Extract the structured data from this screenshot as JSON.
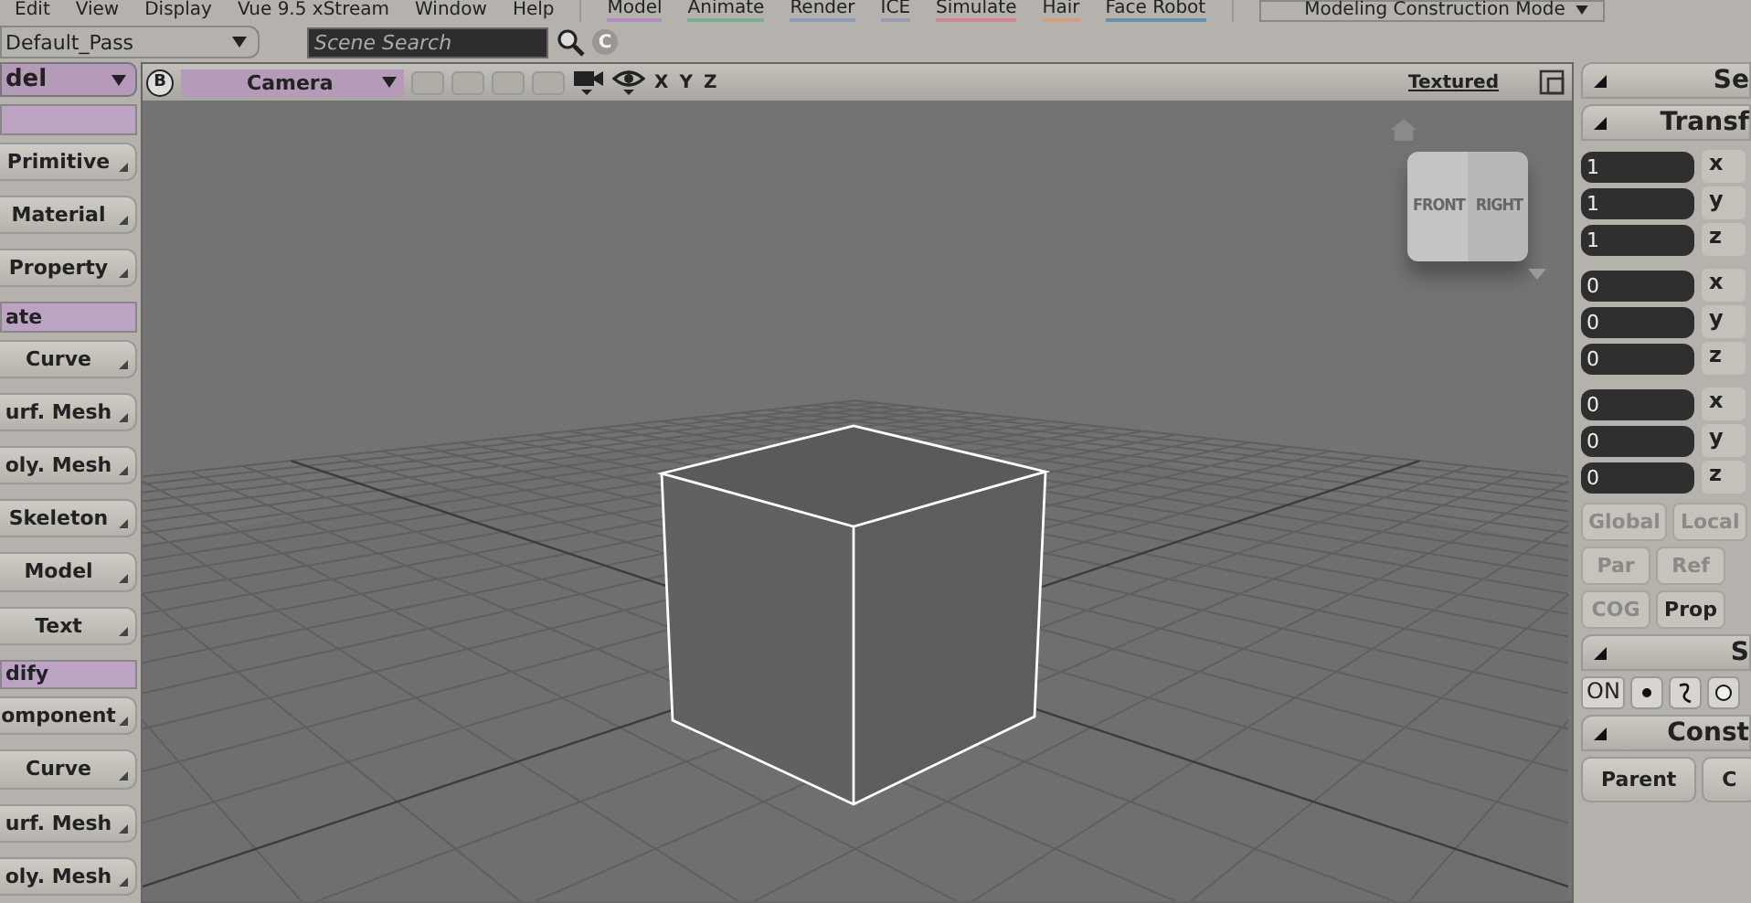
{
  "menu": [
    "Edit",
    "View",
    "Display",
    "Vue 9.5 xStream",
    "Window",
    "Help"
  ],
  "modules": [
    {
      "label": "Model",
      "color": "#b48cc0"
    },
    {
      "label": "Animate",
      "color": "#7cb08c"
    },
    {
      "label": "Render",
      "color": "#8c9cb8"
    },
    {
      "label": "ICE",
      "color": "#9c9cb0"
    },
    {
      "label": "Simulate",
      "color": "#d08890"
    },
    {
      "label": "Hair",
      "color": "#d0a080"
    },
    {
      "label": "Face Robot",
      "color": "#6890a8"
    }
  ],
  "mode": "Modeling Construction Mode",
  "pass": "Default_Pass",
  "search": {
    "placeholder": "Scene Search"
  },
  "search_clear": "C",
  "viewport": {
    "badge": "B",
    "camera": "Camera",
    "axes": [
      "X",
      "Y",
      "Z"
    ],
    "display": "Textured",
    "cube_labels": [
      "FRONT",
      "RIGHT"
    ]
  },
  "left_panel": {
    "header": "del",
    "items": [
      {
        "kind": "blank"
      },
      {
        "kind": "button",
        "label": "Primitive"
      },
      {
        "kind": "button",
        "label": "Material"
      },
      {
        "kind": "button",
        "label": "Property"
      },
      {
        "kind": "section",
        "label": "ate"
      },
      {
        "kind": "button",
        "label": "Curve"
      },
      {
        "kind": "button",
        "label": "urf. Mesh"
      },
      {
        "kind": "button",
        "label": "oly. Mesh"
      },
      {
        "kind": "button",
        "label": "Skeleton"
      },
      {
        "kind": "button",
        "label": "Model"
      },
      {
        "kind": "button",
        "label": "Text"
      },
      {
        "kind": "section",
        "label": "dify"
      },
      {
        "kind": "button",
        "label": "omponent"
      },
      {
        "kind": "button",
        "label": "Curve"
      },
      {
        "kind": "button",
        "label": "urf. Mesh"
      },
      {
        "kind": "button",
        "label": "oly. Mesh"
      }
    ]
  },
  "right_panel": {
    "header": "Se",
    "transform_header": "Transf",
    "groups": [
      [
        {
          "value": "1",
          "axis": "x"
        },
        {
          "value": "1",
          "axis": "y"
        },
        {
          "value": "1",
          "axis": "z"
        }
      ],
      [
        {
          "value": "0",
          "axis": "x"
        },
        {
          "value": "0",
          "axis": "y"
        },
        {
          "value": "0",
          "axis": "z"
        }
      ],
      [
        {
          "value": "0",
          "axis": "x"
        },
        {
          "value": "0",
          "axis": "y"
        },
        {
          "value": "0",
          "axis": "z"
        }
      ]
    ],
    "button_rows": [
      [
        {
          "label": "Global",
          "disabled": true
        },
        {
          "label": "Local",
          "disabled": true
        }
      ],
      [
        {
          "label": "Par",
          "disabled": true
        },
        {
          "label": "Ref",
          "disabled": true
        }
      ],
      [
        {
          "label": "COG",
          "disabled": true
        },
        {
          "label": "Prop",
          "disabled": false
        }
      ]
    ],
    "snap_header": "S",
    "snap_on": "ON",
    "constrain_header": "Const",
    "constrain_buttons": [
      "Parent",
      "C"
    ]
  }
}
